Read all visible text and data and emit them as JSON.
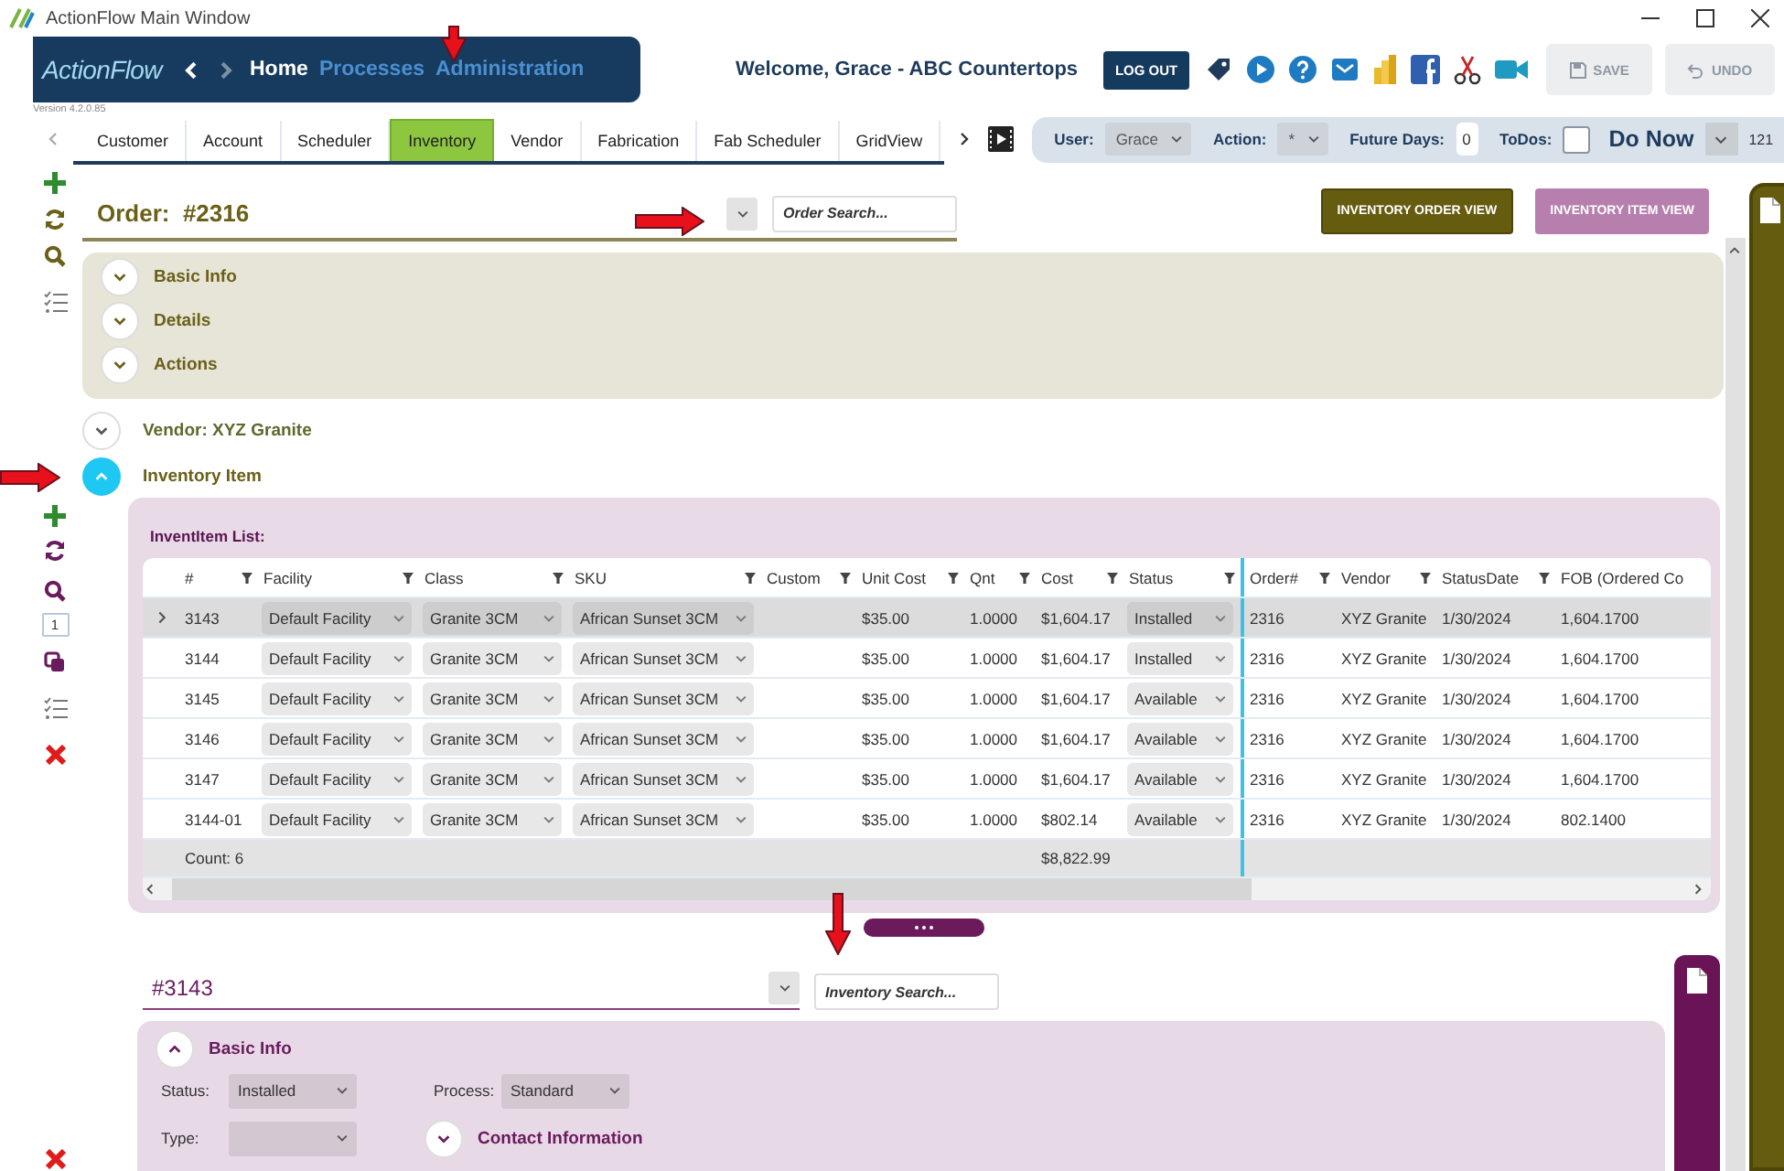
{
  "window": {
    "title": "ActionFlow Main Window"
  },
  "header": {
    "logo": "ActionFlow",
    "version": "Version 4.2.0.85",
    "nav": [
      {
        "label": "Home",
        "selected": true
      },
      {
        "label": "Processes",
        "selected": false
      },
      {
        "label": "Administration",
        "selected": false
      }
    ],
    "welcome": "Welcome, Grace - ABC Countertops",
    "logout": "LOG OUT",
    "save": {
      "label": "SAVE",
      "disabled": true
    },
    "undo": {
      "label": "UNDO",
      "disabled": true
    }
  },
  "tabs": [
    {
      "label": "Customer",
      "selected": false
    },
    {
      "label": "Account",
      "selected": false
    },
    {
      "label": "Scheduler",
      "selected": false
    },
    {
      "label": "Inventory",
      "selected": true
    },
    {
      "label": "Vendor",
      "selected": false
    },
    {
      "label": "Fabrication",
      "selected": false
    },
    {
      "label": "Fab Scheduler",
      "selected": false
    },
    {
      "label": "GridView",
      "selected": false
    }
  ],
  "filters": {
    "user": {
      "label": "User:",
      "value": "Grace"
    },
    "action": {
      "label": "Action:",
      "value": "*"
    },
    "future_days": {
      "label": "Future Days:",
      "value": "0"
    },
    "todos": {
      "label": "ToDos:",
      "checked": false
    },
    "do_now": "Do Now",
    "count": "121"
  },
  "sidebar": {
    "page": "1"
  },
  "order": {
    "title": "Order:  #2316",
    "search_placeholder": "Order Search...",
    "views": [
      {
        "label": "INVENTORY ORDER VIEW",
        "selected": true
      },
      {
        "label": "INVENTORY ITEM VIEW",
        "selected": false
      }
    ],
    "sections": [
      {
        "label": "Basic Info",
        "expanded": false
      },
      {
        "label": "Details",
        "expanded": false
      },
      {
        "label": "Actions",
        "expanded": false
      }
    ]
  },
  "vendor": {
    "label": "Vendor: XYZ Granite",
    "expanded": false
  },
  "inventory_item": {
    "label": "Inventory Item",
    "expanded": true
  },
  "item_list": {
    "title": "InventItem List:",
    "columns": [
      {
        "label": "#",
        "kind": "text",
        "filter": true,
        "pinned": true
      },
      {
        "label": "Facility",
        "kind": "select",
        "filter": true,
        "pinned": true
      },
      {
        "label": "Class",
        "kind": "select",
        "filter": true,
        "pinned": true
      },
      {
        "label": "SKU",
        "kind": "select",
        "filter": true,
        "pinned": true
      },
      {
        "label": "Custom",
        "kind": "text",
        "filter": true,
        "pinned": true
      },
      {
        "label": "Unit Cost",
        "kind": "text",
        "filter": true,
        "pinned": true
      },
      {
        "label": "Qnt",
        "kind": "text",
        "filter": true,
        "pinned": true
      },
      {
        "label": "Cost",
        "kind": "total",
        "filter": true,
        "pinned": true
      },
      {
        "label": "Status",
        "kind": "select",
        "filter": true,
        "pinned": true
      },
      {
        "label": "Order#",
        "kind": "text",
        "filter": true,
        "pinned": false
      },
      {
        "label": "Vendor",
        "kind": "text",
        "filter": true,
        "pinned": false
      },
      {
        "label": "StatusDate",
        "kind": "text",
        "filter": true,
        "pinned": false
      },
      {
        "label": "FOB (Ordered Co",
        "kind": "text",
        "filter": false,
        "pinned": false
      }
    ],
    "rows": [
      {
        "selected": true,
        "cells": [
          "3143",
          "Default Facility",
          "Granite 3CM",
          "African Sunset 3CM",
          "",
          "$35.00",
          "1.0000",
          "$1,604.17",
          "Installed",
          "2316",
          "XYZ Granite",
          "1/30/2024",
          "1,604.1700"
        ]
      },
      {
        "selected": false,
        "cells": [
          "3144",
          "Default Facility",
          "Granite 3CM",
          "African Sunset 3CM",
          "",
          "$35.00",
          "1.0000",
          "$1,604.17",
          "Installed",
          "2316",
          "XYZ Granite",
          "1/30/2024",
          "1,604.1700"
        ]
      },
      {
        "selected": false,
        "cells": [
          "3145",
          "Default Facility",
          "Granite 3CM",
          "African Sunset 3CM",
          "",
          "$35.00",
          "1.0000",
          "$1,604.17",
          "Available",
          "2316",
          "XYZ Granite",
          "1/30/2024",
          "1,604.1700"
        ]
      },
      {
        "selected": false,
        "cells": [
          "3146",
          "Default Facility",
          "Granite 3CM",
          "African Sunset 3CM",
          "",
          "$35.00",
          "1.0000",
          "$1,604.17",
          "Available",
          "2316",
          "XYZ Granite",
          "1/30/2024",
          "1,604.1700"
        ]
      },
      {
        "selected": false,
        "cells": [
          "3147",
          "Default Facility",
          "Granite 3CM",
          "African Sunset 3CM",
          "",
          "$35.00",
          "1.0000",
          "$1,604.17",
          "Available",
          "2316",
          "XYZ Granite",
          "1/30/2024",
          "1,604.1700"
        ]
      },
      {
        "selected": false,
        "cells": [
          "3144-01",
          "Default Facility",
          "Granite 3CM",
          "African Sunset 3CM",
          "",
          "$35.00",
          "1.0000",
          "$802.14",
          "Available",
          "2316",
          "XYZ Granite",
          "1/30/2024",
          "802.1400"
        ]
      }
    ],
    "footer": {
      "count": "Count: 6",
      "total": "$8,822.99"
    }
  },
  "detail": {
    "title": "#3143",
    "search_placeholder": "Inventory Search...",
    "sections": [
      {
        "label": "Basic Info",
        "expanded": true
      },
      {
        "label": "Contact Information",
        "expanded": false
      }
    ],
    "fields": [
      {
        "label": "Status:",
        "value": "Installed"
      },
      {
        "label": "Process:",
        "value": "Standard"
      },
      {
        "label": "Type:"
      }
    ]
  }
}
